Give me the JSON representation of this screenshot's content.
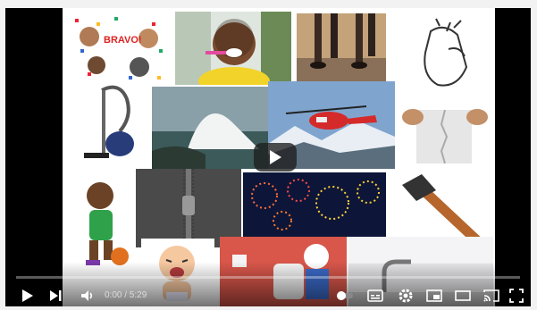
{
  "player": {
    "time_display": "0:00 / 5:29",
    "progress": 0,
    "accent_color": "#ff0000"
  },
  "collage": {
    "bravo_text": "BRAVO!",
    "tiles": [
      "applause-clip-art",
      "child-brushing-teeth-photo",
      "people-walking-photo",
      "finger-snap-drawing",
      "vacuum-cleaner-image",
      "ocean-wave-photo",
      "rescue-helicopter-photo",
      "paper-tearing-photo",
      "basketball-boy-cartoon",
      "zipper-photo",
      "fireworks-photo",
      "hammer-image",
      "crying-baby-cartoon",
      "cartoon-bathroom-toilet",
      "sink-faucet-photo"
    ]
  },
  "icons": {
    "play": "play-icon",
    "next": "next-icon",
    "volume": "volume-icon",
    "subtitles": "subtitles-icon",
    "settings": "gear-icon",
    "miniplayer": "miniplayer-icon",
    "theater": "theater-mode-icon",
    "cast": "cast-icon",
    "fullscreen": "fullscreen-icon"
  }
}
